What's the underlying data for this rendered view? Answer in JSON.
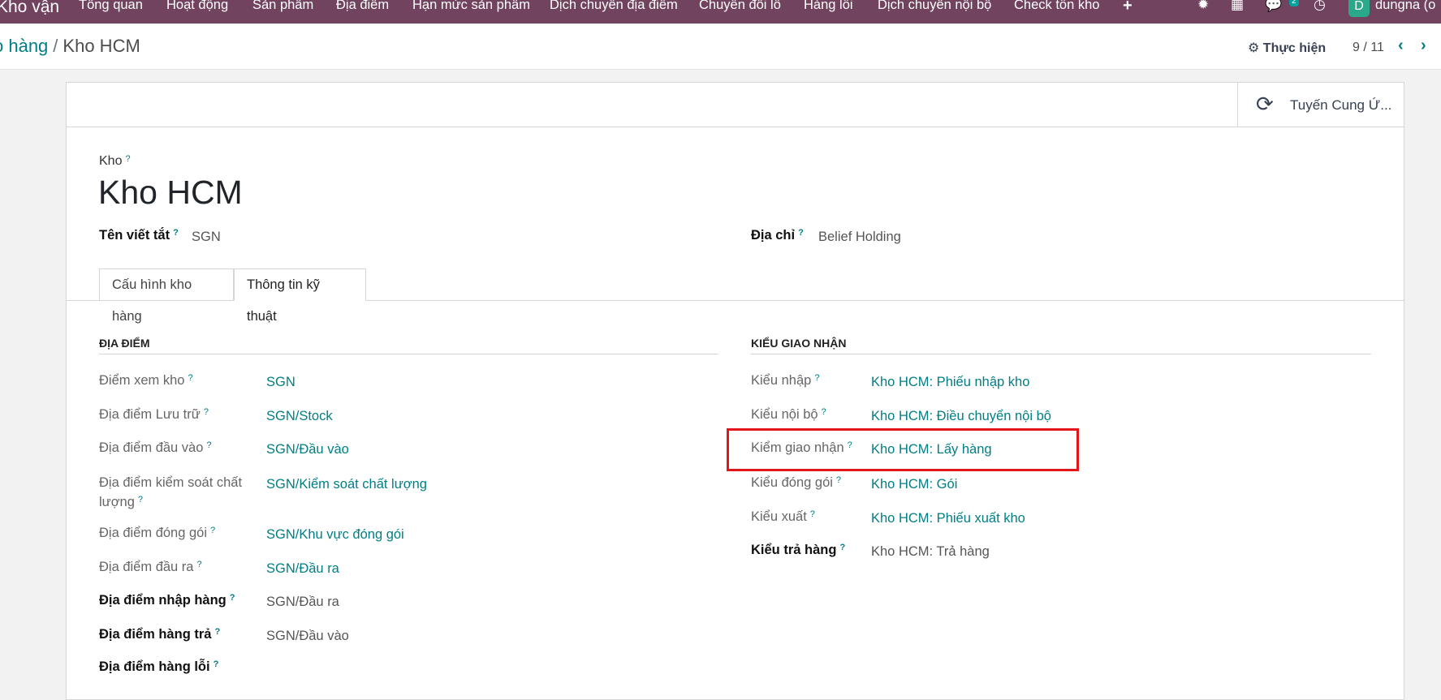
{
  "navbar": {
    "app_name": "Kho vận",
    "menu": [
      "Tổng quan",
      "Hoạt động",
      "Sản phẩm",
      "Địa điểm",
      "Hạn mức sản phẩm",
      "Dịch chuyển địa điểm",
      "Chuyển đổi lô",
      "Hàng lỗi",
      "Dịch chuyển nội bộ",
      "Check tồn kho"
    ],
    "plus_icon": "+",
    "chat_badge": "2",
    "avatar_letter": "D",
    "user": "dungna (o"
  },
  "breadcrumb": {
    "parent": "o hàng",
    "separator": "/",
    "current": "Kho HCM"
  },
  "control": {
    "action_label": "Thực hiện",
    "pager": "9 / 11"
  },
  "smart_button": {
    "label": "Tuyến Cung Ứ..."
  },
  "form": {
    "name_label": "Kho",
    "name_value": "Kho HCM",
    "short_name_label": "Tên viết tắt",
    "short_name_value": "SGN",
    "address_label": "Địa chỉ",
    "address_value": "Belief Holding",
    "help_mark": "?"
  },
  "tabs": [
    "Cấu hình kho hàng",
    "Thông tin kỹ thuật"
  ],
  "locations": {
    "title": "ĐỊA ĐIỂM",
    "rows": [
      {
        "label": "Điểm xem kho",
        "value": "SGN"
      },
      {
        "label": "Địa điểm Lưu trữ",
        "value": "SGN/Stock"
      },
      {
        "label": "Địa điểm đầu vào",
        "value": "SGN/Đầu vào"
      },
      {
        "label": "Địa điểm kiểm soát chất",
        "label2": "lượng",
        "value": "SGN/Kiểm soát chất lượng"
      },
      {
        "label": "Địa điểm đóng gói",
        "value": "SGN/Khu vực đóng gói"
      },
      {
        "label": "Địa điểm đầu ra",
        "value": "SGN/Đầu ra"
      },
      {
        "label": "Địa điểm nhập hàng",
        "value": "SGN/Đầu ra"
      },
      {
        "label": "Địa điểm hàng trả",
        "value": "SGN/Đầu vào"
      },
      {
        "label": "Địa điểm hàng lỗi",
        "value": ""
      }
    ]
  },
  "operation_types": {
    "title": "KIỂU GIAO NHẬN",
    "rows": [
      {
        "label": "Kiểu nhập",
        "value": "Kho HCM: Phiếu nhập kho"
      },
      {
        "label": "Kiểu nội bộ",
        "value": "Kho HCM: Điều chuyển nội bộ"
      },
      {
        "label": "Kiểm giao nhận",
        "value": "Kho HCM: Lấy hàng"
      },
      {
        "label": "Kiểu đóng gói",
        "value": "Kho HCM: Gói"
      },
      {
        "label": "Kiểu xuất",
        "value": "Kho HCM: Phiếu xuất kho"
      },
      {
        "label": "Kiểu trả hàng",
        "value": "Kho HCM: Trả hàng"
      }
    ]
  },
  "colors": {
    "navbar": "#71435f",
    "link": "#017e84",
    "highlight": "#e3151a"
  }
}
